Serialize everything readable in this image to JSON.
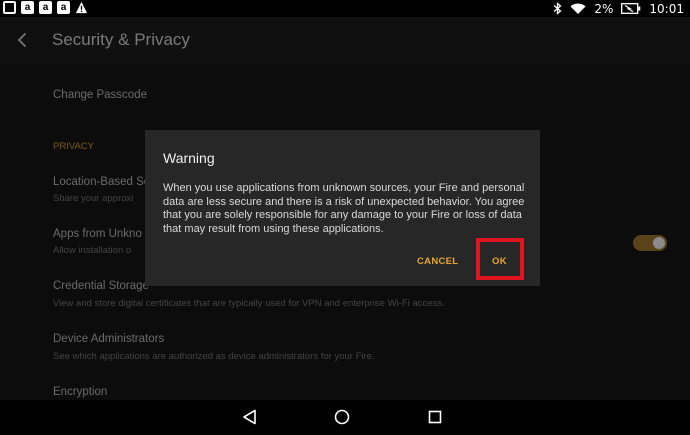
{
  "status_bar": {
    "notification_icons": [
      "amazon-icon",
      "amazon-icon",
      "amazon-icon",
      "warning-icon"
    ],
    "amazon_letter": "a",
    "battery": "2%",
    "time": "10:01"
  },
  "app_bar": {
    "title": "Security & Privacy"
  },
  "settings": {
    "change_passcode": "Change Passcode",
    "privacy_header": "PRIVACY",
    "location_title": "Location-Based Se",
    "location_sub": "Share your approxi",
    "apps_unknown_title": "Apps from Unkno",
    "apps_unknown_sub": "Allow installation o",
    "credential_title": "Credential Storage",
    "credential_sub": "View and store digital certificates that are typically used for VPN and enterprise Wi-Fi access.",
    "device_admin_title": "Device Administrators",
    "device_admin_sub": "See which applications are authorized as device administrators for your Fire.",
    "encryption_title": "Encryption"
  },
  "dialog": {
    "title": "Warning",
    "message": "When you use applications from unknown sources, your Fire and personal data are less secure and there is a risk of unexpected behavior. You agree that you are solely responsible for any damage to your Fire or loss of data that may result from using these applications.",
    "cancel_label": "CANCEL",
    "ok_label": "OK"
  },
  "colors": {
    "accent": "#e7a531",
    "highlight": "#e0141e"
  }
}
